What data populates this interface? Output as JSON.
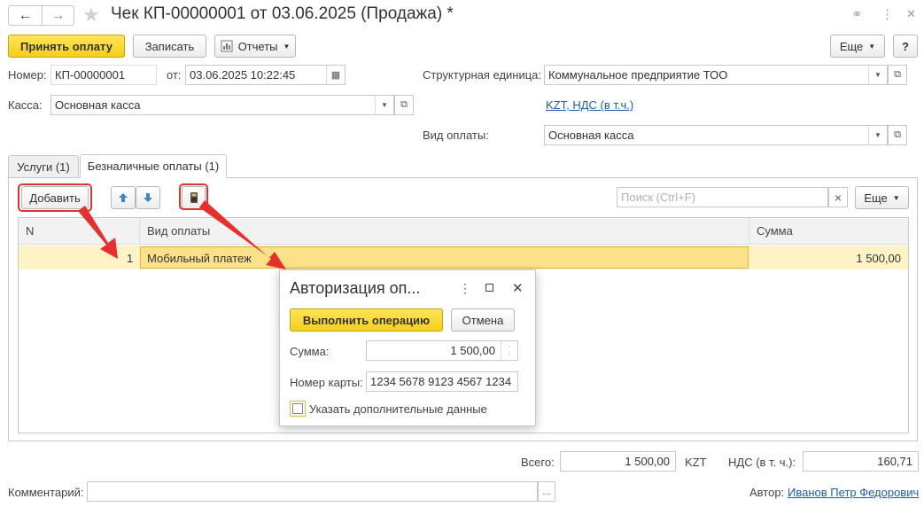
{
  "window": {
    "title": "Чек КП-00000001 от 03.06.2025 (Продажа) *",
    "back_glyph": "←",
    "forward_glyph": "→",
    "star_glyph": "★",
    "link_glyph": "⚭",
    "more_glyph": "⋮",
    "close_glyph": "✕"
  },
  "toolbar": {
    "accept_payment": "Принять оплату",
    "save": "Записать",
    "reports": "Отчеты",
    "more": "Еще",
    "help": "?"
  },
  "header": {
    "number_label": "Номер:",
    "number_value": "КП-00000001",
    "date_label": "от:",
    "date_value": "03.06.2025 10:22:45",
    "cash_label": "Касса:",
    "cash_value": "Основная касса",
    "unit_label": "Структурная единица:",
    "unit_value": "Коммунальное предприятие ТОО",
    "currency_link": "KZT, НДС (в т.ч.)",
    "payment_type_label": "Вид оплаты:",
    "payment_type_value": "Основная касса"
  },
  "tabs": [
    {
      "label": "Услуги (1)"
    },
    {
      "label": "Безналичные оплаты (1)"
    }
  ],
  "table_toolbar": {
    "add": "Добавить",
    "up_glyph": "🡅",
    "down_glyph": "🡇",
    "search_placeholder": "Поиск (Ctrl+F)",
    "clear_glyph": "×",
    "more": "Еще"
  },
  "table": {
    "headers": [
      "N",
      "Вид оплаты",
      "Сумма"
    ],
    "rows": [
      {
        "n": "1",
        "type": "Мобильный платеж",
        "sum": "1 500,00"
      }
    ]
  },
  "dialog": {
    "title": "Авторизация оп...",
    "execute": "Выполнить операцию",
    "cancel": "Отмена",
    "sum_label": "Сумма:",
    "sum_value": "1 500,00",
    "card_label": "Номер карты:",
    "card_value": "1234 5678 9123 4567 1234",
    "extra_label": "Указать дополнительные данные",
    "extra_checked": false
  },
  "footer": {
    "total_label": "Всего:",
    "total_value": "1 500,00",
    "currency": "KZT",
    "vat_label": "НДС (в т. ч.):",
    "vat_value": "160,71",
    "comment_label": "Комментарий:",
    "comment_value": "",
    "comment_button": "...",
    "author_label": "Автор:",
    "author_value": "Иванов Петр Федорович"
  },
  "colors": {
    "accent_yellow": "#f5cf1a",
    "row_selected": "#fdf3c6",
    "annotation_red": "#e53030",
    "link_blue": "#1b5fa8"
  }
}
